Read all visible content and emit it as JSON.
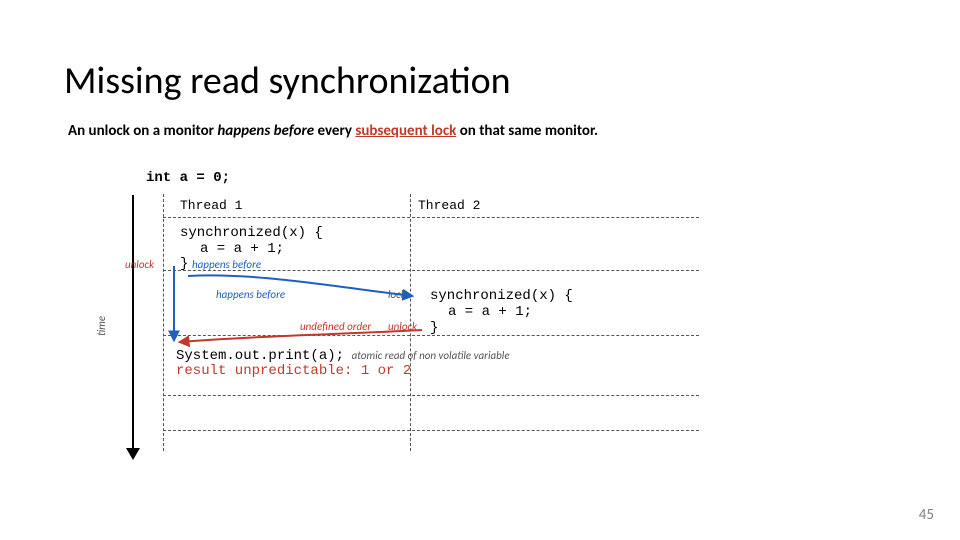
{
  "title": "Missing read synchronization",
  "rule": {
    "prefix": "An unlock on a monitor ",
    "italic": "happens before",
    "mid": " every ",
    "highlight": "subsequent lock",
    "suffix": " on that same monitor."
  },
  "diagram": {
    "init_code": "int a = 0;",
    "time_axis": "time",
    "thread1_label": "Thread 1",
    "thread2_label": "Thread 2",
    "t1_sync_open": "synchronized(x) {",
    "increment": "a = a + 1;",
    "close_brace": "}",
    "unlock": "unlock",
    "lock": "lock",
    "happens_before": "happens before",
    "undefined_order": "undefined order",
    "t2_sync_open": "synchronized(x) {",
    "print_stmt": "System.out.print(a);",
    "atomic_note": "atomic read of non volatile variable",
    "result_line": "result unpredictable: 1 or 2"
  },
  "page_number": "45"
}
